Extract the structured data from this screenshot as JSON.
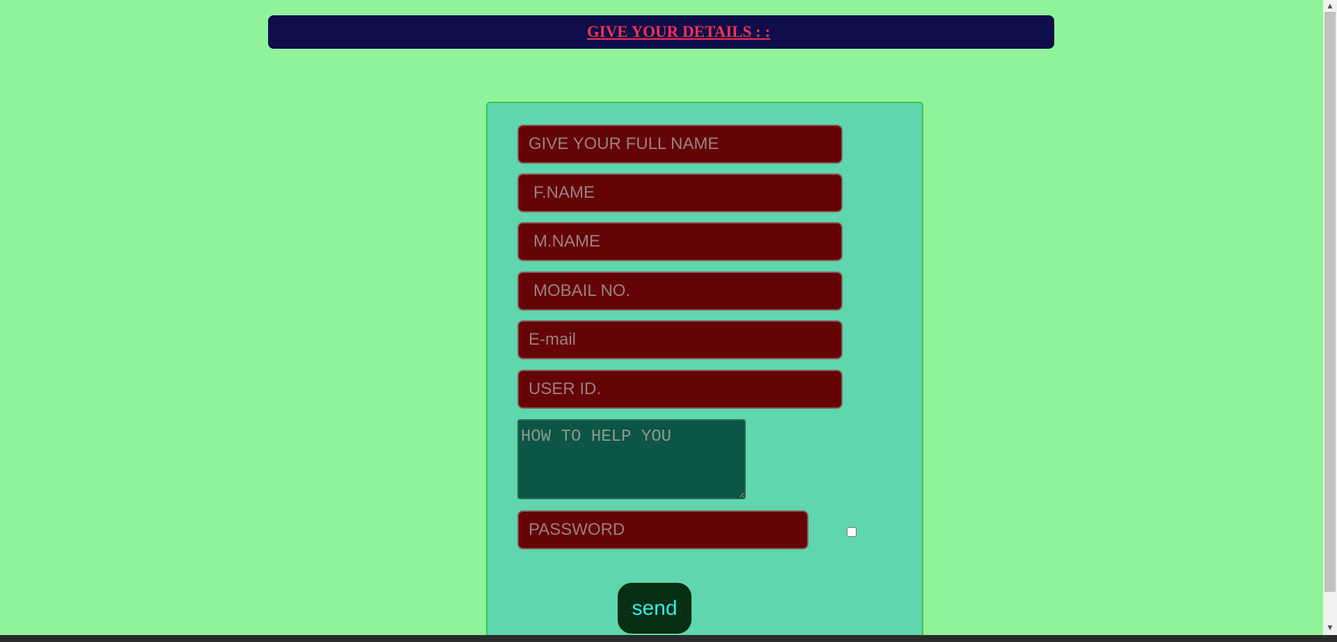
{
  "header": {
    "title": "GIVE YOUR DETAILS : :"
  },
  "form": {
    "full_name_placeholder": "GIVE YOUR FULL NAME",
    "father_name_placeholder": "F.NAME",
    "mother_name_placeholder": "M.NAME",
    "mobile_placeholder": "MOBAIL NO.",
    "email_placeholder": "E-mail",
    "user_id_placeholder": "USER ID.",
    "help_placeholder": "HOW TO HELP YOU",
    "password_placeholder": "PASSWORD",
    "show_password_checked": false,
    "send_label": "send"
  },
  "colors": {
    "page_background": "#90f39a",
    "header_background": "#0f0e4b",
    "header_text": "#f0324e",
    "panel_background": "#5fd6ad",
    "field_background": "#640407",
    "textarea_background": "#0d5544",
    "button_background": "#082e13",
    "button_text": "#2ff0ea"
  },
  "icons": {
    "scroll_up": "arrow-up-icon",
    "scroll_down": "arrow-down-icon"
  }
}
